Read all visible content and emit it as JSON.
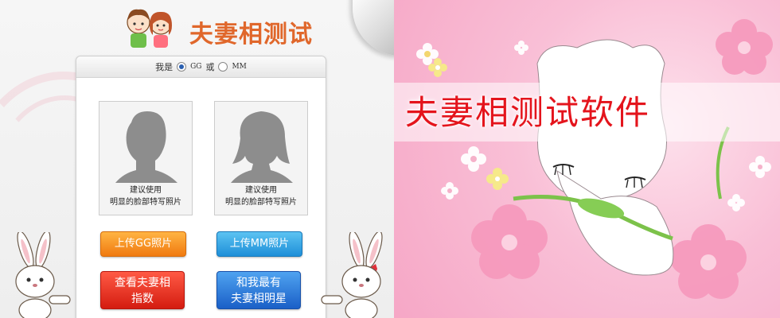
{
  "app": {
    "title": "夫妻相测试",
    "gender": {
      "label": "我是",
      "option_gg": "GG",
      "separator": "或",
      "option_mm": "MM",
      "selected": "GG"
    },
    "photos": {
      "gg_caption_line1": "建议使用",
      "gg_caption_line2": "明显的脸部特写照片",
      "mm_caption_line1": "建议使用",
      "mm_caption_line2": "明显的脸部特写照片"
    },
    "buttons": {
      "upload_gg": "上传GG照片",
      "upload_mm": "上传MM照片",
      "view_line1": "查看夫妻相",
      "view_line2": "指数",
      "star_line1": "和我最有",
      "star_line2": "夫妻相明星"
    },
    "colors": {
      "title": "#e0672b",
      "upload_gg": "#f07a10",
      "upload_mm": "#1e8fd8",
      "view": "#d41c10",
      "star": "#1a5fc7"
    }
  },
  "banner": {
    "title": "夫妻相测试软件",
    "title_color": "#e4141c",
    "art": "pink-flowers-white-cat-illustration"
  }
}
